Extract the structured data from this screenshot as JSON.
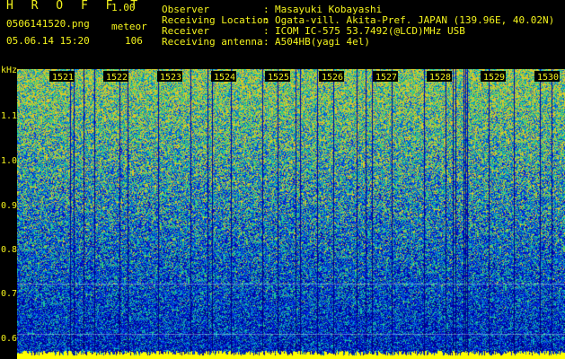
{
  "header": {
    "app_name": "H R O F F T",
    "version": "1.00",
    "filename": "0506141520.png",
    "mode": "meteor",
    "datetime": "05.06.14 15:20",
    "count": "106",
    "info": [
      {
        "label": "Observer",
        "sep": ":",
        "value": "Masayuki Kobayashi"
      },
      {
        "label": "Receiving Location",
        "sep": ":",
        "value": "Ogata-vill. Akita-Pref. JAPAN (139.96E, 40.02N)"
      },
      {
        "label": "Receiver",
        "sep": ":",
        "value": "ICOM IC-575 53.7492(@LCD)MHz USB"
      },
      {
        "label": "Receiving antenna",
        "sep": ":",
        "value": "A504HB(yagi 4el)"
      }
    ]
  },
  "spectrogram": {
    "y_unit": "kHz",
    "y_ticks": [
      "1.1",
      "1.0",
      "0.9",
      "0.8",
      "0.7",
      "0.6"
    ],
    "minute_labels": [
      "1521",
      "1522",
      "1523",
      "1524",
      "1525",
      "1526",
      "1527",
      "1528",
      "1529",
      "1530"
    ],
    "colors": {
      "text": "#f4f41c",
      "background": "#000000",
      "baseline": "#ffff00"
    }
  }
}
